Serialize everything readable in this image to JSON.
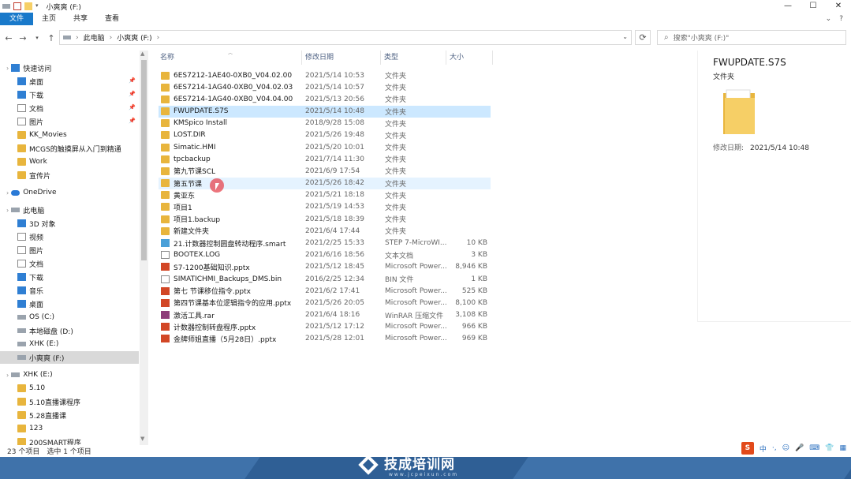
{
  "window": {
    "title": "小爽爽 (F:)",
    "controls": [
      "—",
      "☐",
      "✕"
    ]
  },
  "ribbon": {
    "tabs": [
      "文件",
      "主页",
      "共享",
      "查看"
    ],
    "right": [
      "⌄",
      "?"
    ]
  },
  "address": {
    "segments": [
      "此电脑",
      "小爽爽 (F:)"
    ],
    "search_placeholder": "搜索\"小爽爽 (F:)\""
  },
  "sidebar": {
    "items": [
      {
        "label": "快速访问",
        "icon": "star-icon",
        "kind": "blue",
        "indent": 0
      },
      {
        "label": "桌面",
        "icon": "desktop-icon",
        "kind": "blue",
        "indent": 1,
        "pinned": true
      },
      {
        "label": "下载",
        "icon": "download-icon",
        "kind": "blue",
        "indent": 1,
        "pinned": true
      },
      {
        "label": "文档",
        "icon": "document-icon",
        "kind": "doc",
        "indent": 1,
        "pinned": true
      },
      {
        "label": "图片",
        "icon": "picture-icon",
        "kind": "doc",
        "indent": 1,
        "pinned": true
      },
      {
        "label": "KK_Movies",
        "icon": "folder-icon",
        "kind": "fold",
        "indent": 1
      },
      {
        "label": "MCGS的触摸屏从入门到精通",
        "icon": "folder-icon",
        "kind": "fold",
        "indent": 1
      },
      {
        "label": "Work",
        "icon": "folder-icon",
        "kind": "fold",
        "indent": 1
      },
      {
        "label": "宣传片",
        "icon": "folder-icon",
        "kind": "fold",
        "indent": 1
      },
      {
        "label": "OneDrive",
        "icon": "cloud-icon",
        "kind": "cloud",
        "indent": 0
      },
      {
        "label": "此电脑",
        "icon": "computer-icon",
        "kind": "drive",
        "indent": 0
      },
      {
        "label": "3D 对象",
        "icon": "3d-objects-icon",
        "kind": "blue",
        "indent": 1
      },
      {
        "label": "视频",
        "icon": "video-icon",
        "kind": "doc",
        "indent": 1
      },
      {
        "label": "图片",
        "icon": "picture-icon",
        "kind": "doc",
        "indent": 1
      },
      {
        "label": "文档",
        "icon": "document-icon",
        "kind": "doc",
        "indent": 1
      },
      {
        "label": "下载",
        "icon": "download-icon",
        "kind": "blue",
        "indent": 1
      },
      {
        "label": "音乐",
        "icon": "music-icon",
        "kind": "blue",
        "indent": 1
      },
      {
        "label": "桌面",
        "icon": "desktop-icon",
        "kind": "blue",
        "indent": 1
      },
      {
        "label": "OS (C:)",
        "icon": "drive-icon",
        "kind": "drive",
        "indent": 1
      },
      {
        "label": "本地磁盘 (D:)",
        "icon": "drive-icon",
        "kind": "drive",
        "indent": 1
      },
      {
        "label": "XHK (E:)",
        "icon": "drive-icon",
        "kind": "drive",
        "indent": 1
      },
      {
        "label": "小爽爽 (F:)",
        "icon": "drive-icon",
        "kind": "drive",
        "indent": 1,
        "selected": true
      },
      {
        "label": "XHK (E:)",
        "icon": "drive-icon",
        "kind": "drive",
        "indent": 0
      },
      {
        "label": "5.10",
        "icon": "folder-icon",
        "kind": "fold",
        "indent": 1
      },
      {
        "label": "5.10直播课程序",
        "icon": "folder-icon",
        "kind": "fold",
        "indent": 1
      },
      {
        "label": "5.28直播课",
        "icon": "folder-icon",
        "kind": "fold",
        "indent": 1
      },
      {
        "label": "123",
        "icon": "folder-icon",
        "kind": "fold",
        "indent": 1
      },
      {
        "label": "200SMART程序",
        "icon": "folder-icon",
        "kind": "fold",
        "indent": 1
      }
    ]
  },
  "columns": {
    "name": "名称",
    "date": "修改日期",
    "type": "类型",
    "size": "大小"
  },
  "files": [
    {
      "name": "6ES7212-1AE40-0XB0_V04.02.00",
      "date": "2021/5/14 10:53",
      "type": "文件夹",
      "size": "",
      "icon": "folder-icon",
      "kind": "fold"
    },
    {
      "name": "6ES7214-1AG40-0XB0_V04.02.03",
      "date": "2021/5/14 10:57",
      "type": "文件夹",
      "size": "",
      "icon": "folder-icon",
      "kind": "fold"
    },
    {
      "name": "6ES7214-1AG40-0XB0_V04.04.00",
      "date": "2021/5/13 20:56",
      "type": "文件夹",
      "size": "",
      "icon": "folder-icon",
      "kind": "fold"
    },
    {
      "name": "FWUPDATE.S7S",
      "date": "2021/5/14 10:48",
      "type": "文件夹",
      "size": "",
      "icon": "folder-icon",
      "kind": "fold",
      "state": "sel"
    },
    {
      "name": "KMSpico Install",
      "date": "2018/9/28 15:08",
      "type": "文件夹",
      "size": "",
      "icon": "folder-icon",
      "kind": "fold"
    },
    {
      "name": "LOST.DIR",
      "date": "2021/5/26 19:48",
      "type": "文件夹",
      "size": "",
      "icon": "folder-icon",
      "kind": "fold"
    },
    {
      "name": "Simatic.HMI",
      "date": "2021/5/20 10:01",
      "type": "文件夹",
      "size": "",
      "icon": "folder-icon",
      "kind": "fold"
    },
    {
      "name": "tpcbackup",
      "date": "2021/7/14 11:30",
      "type": "文件夹",
      "size": "",
      "icon": "folder-icon",
      "kind": "fold"
    },
    {
      "name": "第九节课SCL",
      "date": "2021/6/9 17:54",
      "type": "文件夹",
      "size": "",
      "icon": "folder-icon",
      "kind": "fold"
    },
    {
      "name": "第五节课",
      "date": "2021/5/26 18:42",
      "type": "文件夹",
      "size": "",
      "icon": "folder-icon",
      "kind": "fold",
      "state": "hov"
    },
    {
      "name": "黄亚东",
      "date": "2021/5/21 18:18",
      "type": "文件夹",
      "size": "",
      "icon": "folder-icon",
      "kind": "fold"
    },
    {
      "name": "项目1",
      "date": "2021/5/19 14:53",
      "type": "文件夹",
      "size": "",
      "icon": "folder-icon",
      "kind": "fold"
    },
    {
      "name": "项目1.backup",
      "date": "2021/5/18 18:39",
      "type": "文件夹",
      "size": "",
      "icon": "folder-icon",
      "kind": "fold"
    },
    {
      "name": "新建文件夹",
      "date": "2021/6/4 17:44",
      "type": "文件夹",
      "size": "",
      "icon": "folder-icon",
      "kind": "fold"
    },
    {
      "name": "21.计数器控制圆盘转动程序.smart",
      "date": "2021/2/25 15:33",
      "type": "STEP 7-MicroWI...",
      "size": "10 KB",
      "icon": "smart-file-icon",
      "kind": "smart"
    },
    {
      "name": "BOOTEX.LOG",
      "date": "2021/6/16 18:56",
      "type": "文本文档",
      "size": "3 KB",
      "icon": "text-file-icon",
      "kind": "doc"
    },
    {
      "name": "S7-1200基础知识.pptx",
      "date": "2021/5/12 18:45",
      "type": "Microsoft Power...",
      "size": "8,946 KB",
      "icon": "pptx-icon",
      "kind": "ppt"
    },
    {
      "name": "SIMATICHMI_Backups_DMS.bin",
      "date": "2016/2/25 12:34",
      "type": "BIN 文件",
      "size": "1 KB",
      "icon": "bin-file-icon",
      "kind": "doc"
    },
    {
      "name": "第七 节课移位指令.pptx",
      "date": "2021/6/2 17:41",
      "type": "Microsoft Power...",
      "size": "525 KB",
      "icon": "pptx-icon",
      "kind": "ppt"
    },
    {
      "name": "第四节课基本位逻辑指令的应用.pptx",
      "date": "2021/5/26 20:05",
      "type": "Microsoft Power...",
      "size": "8,100 KB",
      "icon": "pptx-icon",
      "kind": "ppt"
    },
    {
      "name": "激活工具.rar",
      "date": "2021/6/4 18:16",
      "type": "WinRAR 压缩文件",
      "size": "3,108 KB",
      "icon": "rar-icon",
      "kind": "rar"
    },
    {
      "name": "计数器控制转盘程序.pptx",
      "date": "2021/5/12 17:12",
      "type": "Microsoft Power...",
      "size": "966 KB",
      "icon": "pptx-icon",
      "kind": "ppt"
    },
    {
      "name": "金牌师姐直播（5月28日）.pptx",
      "date": "2021/5/28 12:01",
      "type": "Microsoft Power...",
      "size": "969 KB",
      "icon": "pptx-icon",
      "kind": "ppt"
    }
  ],
  "preview": {
    "name": "FWUPDATE.S7S",
    "type": "文件夹",
    "date_label": "修改日期:",
    "date_value": "2021/5/14 10:48"
  },
  "status": {
    "count": "23 个项目",
    "selected": "选中 1 个项目"
  },
  "ime": {
    "logo": "S",
    "items": [
      "中",
      "·,",
      "☺",
      "🎤",
      "⌨",
      "👕",
      "▦"
    ]
  },
  "banner": {
    "brand": "技成培训网",
    "url": "www.jcpeixun.com"
  },
  "colors": {
    "accent": "#1979ca",
    "selected_row": "#cce8ff",
    "hover_row": "#e5f3ff",
    "folder": "#e8b53d",
    "banner": "#2f5f95"
  }
}
